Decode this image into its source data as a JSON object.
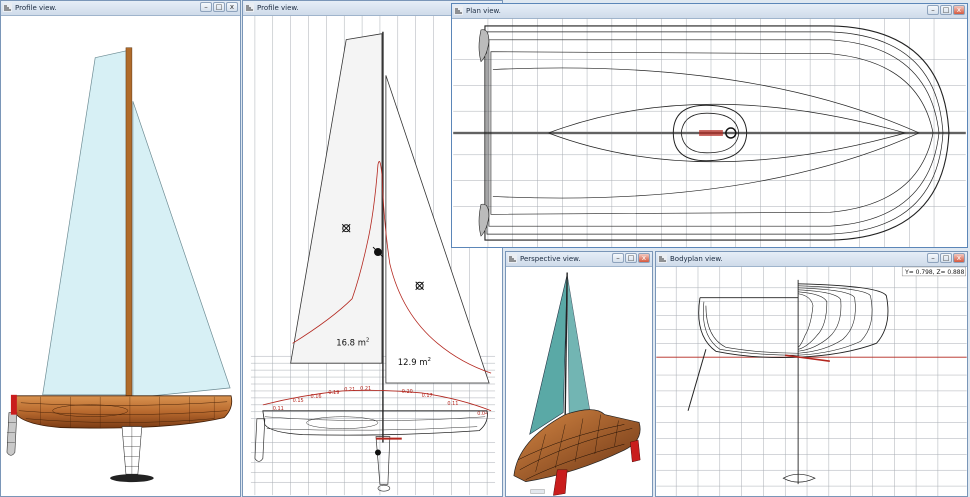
{
  "windows": {
    "profile1": {
      "title": "Profile view."
    },
    "profile2": {
      "title": "Profile view.",
      "sail_area_main": "16.8 m",
      "sail_area_jib": "12.9 m",
      "area_exp": "2",
      "curve_labels": [
        "0.11",
        "0.15",
        "0.16",
        "0.19",
        "0.21",
        "0.21",
        "0.20",
        "0.17",
        "0.11",
        "0.04"
      ]
    },
    "plan": {
      "title": "Plan view."
    },
    "perspective": {
      "title": "Perspective view."
    },
    "bodyplan": {
      "title": "Bodyplan view.",
      "readout": "Y= 0.798,  Z= 0.888"
    }
  },
  "window_buttons": {
    "minimize": "–",
    "maximize": "□",
    "close": "x"
  },
  "colors": {
    "sail": "#d7f0f5",
    "hull": "#b8692e",
    "hull_dark": "#6b3414",
    "mast": "#b06b2a",
    "curve": "#b3261e",
    "grid": "#9aa0a8",
    "persp_sail": "#5aa9a6",
    "persp_fin": "#c91d1d"
  }
}
